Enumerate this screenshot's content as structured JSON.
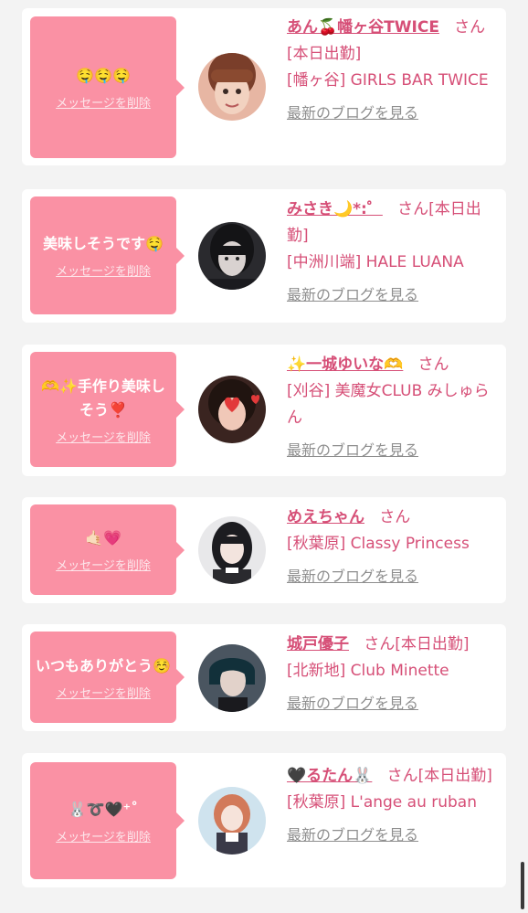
{
  "colors": {
    "bubble": "#fa91a4",
    "accent": "#d64f77",
    "link_gray": "#8e8e8e",
    "background": "#f3f3f3"
  },
  "delete_label": "メッセージを削除",
  "blog_label": "最新のブログを見る",
  "cards": [
    {
      "message": "🤤🤤🤤",
      "name": "あん🍒幡ヶ谷TWICE",
      "san": "さん",
      "status": "[本日出勤]",
      "shop": "[幡ヶ谷] GIRLS BAR TWICE"
    },
    {
      "message": "美味しそうです🤤",
      "name": "みさき🌙*:゜",
      "san": "さん",
      "status": "[本日出勤]",
      "shop": "[中洲川端] HALE LUANA"
    },
    {
      "message": "🫶✨手作り美味しそう❣️",
      "name": "✨一城ゆいな🫶",
      "san": "さん",
      "status": "",
      "shop": "[刈谷] 美魔女CLUB みしゅらん"
    },
    {
      "message": "🤙🏻💗",
      "name": "めえちゃん",
      "san": "さん",
      "status": "",
      "shop": "[秋葉原] Classy Princess"
    },
    {
      "message": "いつもありがとう☺️",
      "name": "城戸優子",
      "san": "さん",
      "status": "[本日出勤]",
      "shop": "[北新地] Club Minette"
    },
    {
      "message": "🐰➰🖤⁺˚",
      "name": "🖤るたん🐰",
      "san": "さん",
      "status": "[本日出勤]",
      "shop": "[秋葉原] L'ange au ruban"
    }
  ]
}
